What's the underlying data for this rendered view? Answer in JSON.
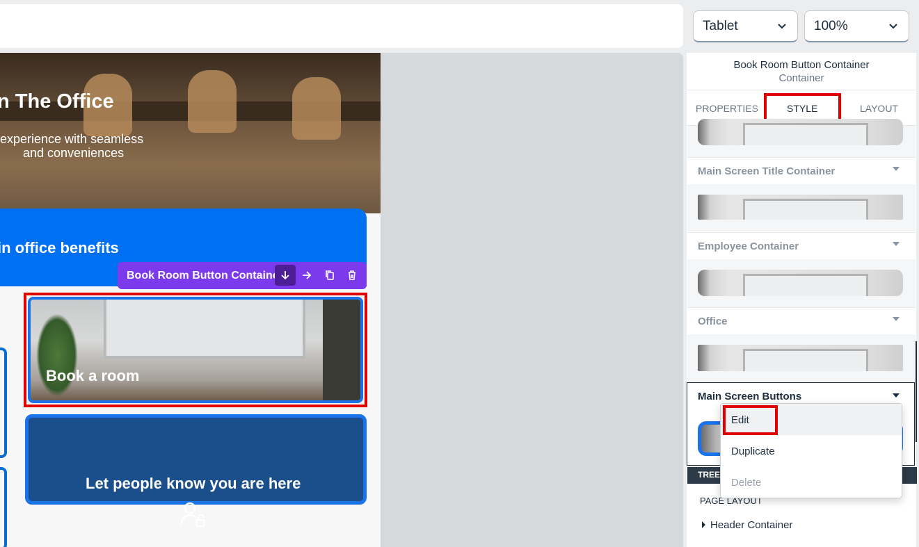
{
  "top_bar": {
    "device_select": {
      "value": "Tablet"
    },
    "zoom_select": {
      "value": "100%"
    }
  },
  "canvas": {
    "hero": {
      "title": "n The Office",
      "subtitle_line1": "experience with seamless",
      "subtitle_line2": "and conveniences"
    },
    "benefits_banner": {
      "text": "in office benefits"
    },
    "selection_toolbar": {
      "label": "Book Room Button Container",
      "actions": [
        "move-down-icon",
        "move-right-icon",
        "copy-icon",
        "trash-icon"
      ]
    },
    "book_room_card": {
      "label": "Book a room"
    },
    "let_people_card": {
      "label": "Let people know you are here"
    }
  },
  "right_panel": {
    "selected_element": {
      "name": "Book Room Button Container",
      "type": "Container"
    },
    "tabs": [
      {
        "label": "PROPERTIES",
        "active": false
      },
      {
        "label": "STYLE",
        "active": true
      },
      {
        "label": "LAYOUT",
        "active": false
      }
    ],
    "style_sections": [
      {
        "label": "Main Screen Title Container"
      },
      {
        "label": "Employee Container"
      },
      {
        "label": "Office"
      },
      {
        "label": "Main Screen Buttons"
      }
    ],
    "context_menu": {
      "items": [
        {
          "label": "Edit",
          "enabled": true
        },
        {
          "label": "Duplicate",
          "enabled": true
        },
        {
          "label": "Delete",
          "enabled": false
        }
      ]
    },
    "tree": {
      "header": "TREE",
      "page_layout": "PAGE LAYOUT",
      "items": [
        {
          "label": "Header Container"
        }
      ]
    }
  },
  "colors": {
    "accent_blue": "#0070f2",
    "toolbar_purple": "#7c3aed",
    "highlight_red": "#e00000",
    "card_dark_blue": "#1b4f8c"
  }
}
